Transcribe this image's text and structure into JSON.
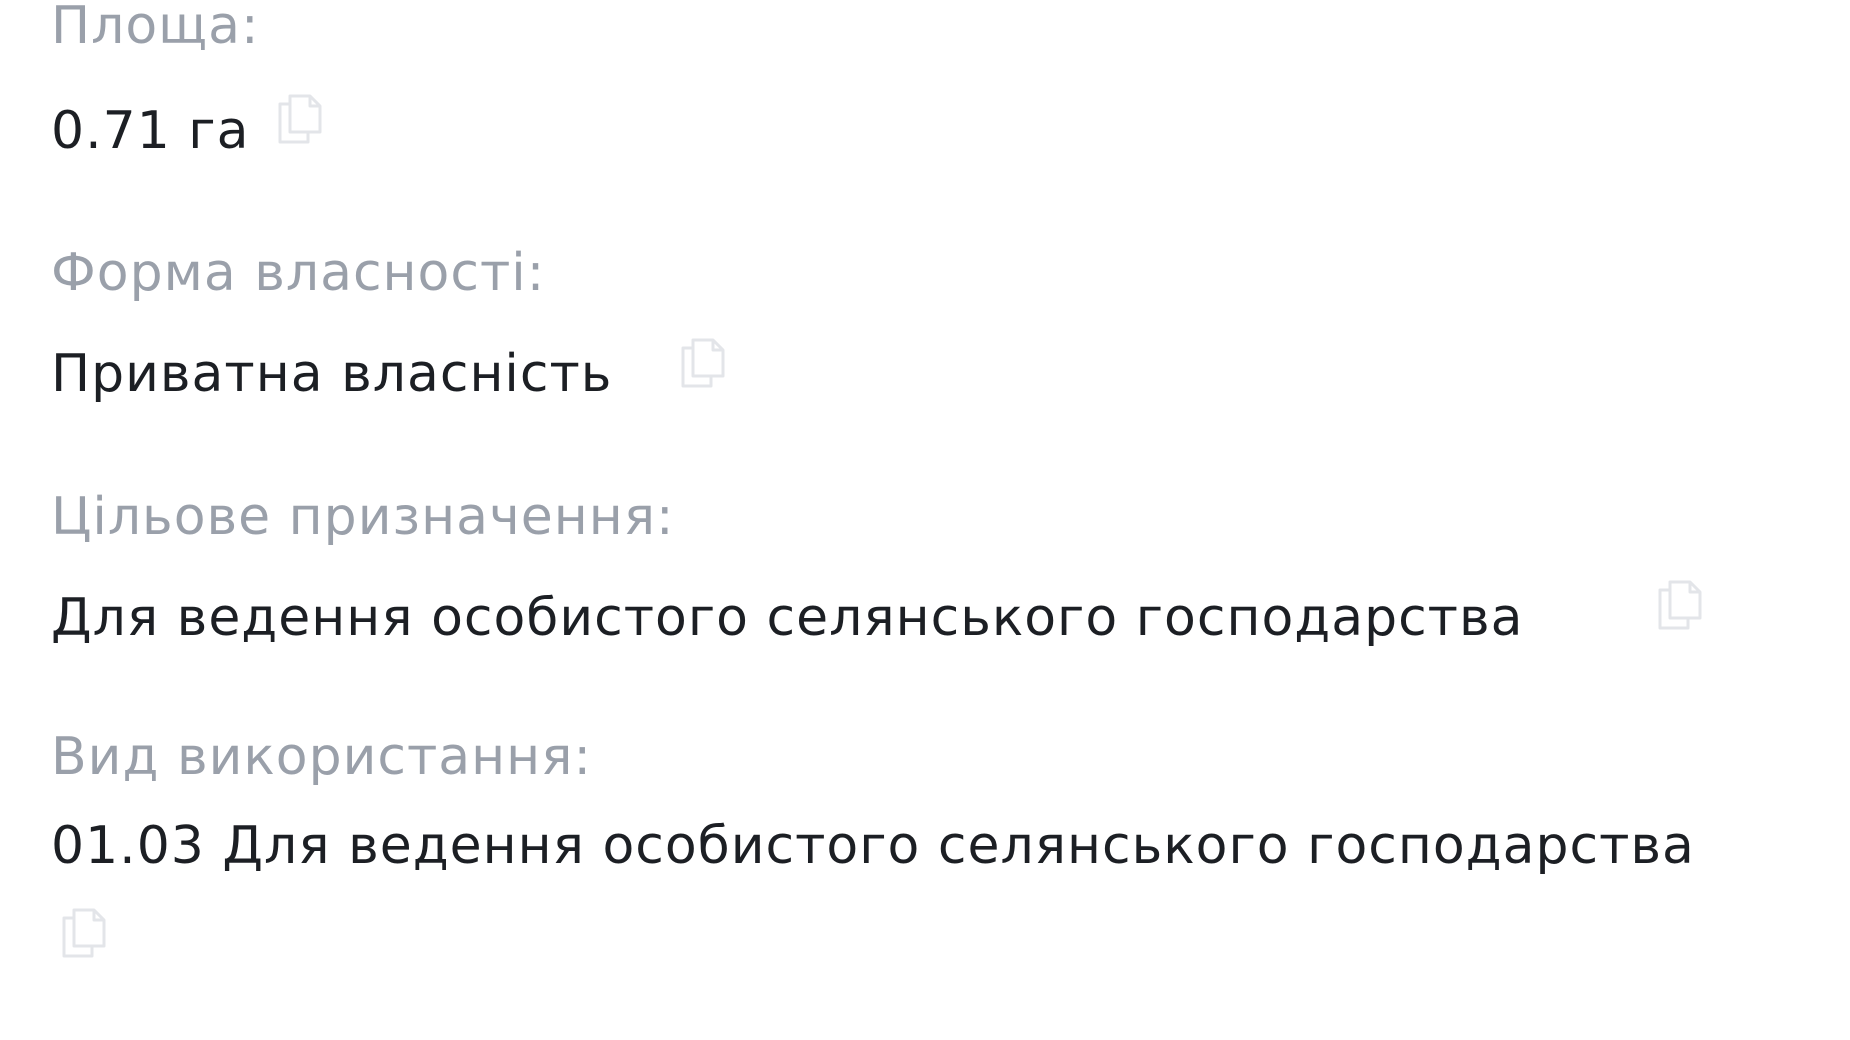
{
  "fields": [
    {
      "label": "Площа:",
      "value": "0.71 га"
    },
    {
      "label": "Форма власності:",
      "value": "Приватна власність"
    },
    {
      "label": "Цільове призначення:",
      "value": "Для ведення особистого селянського господарства"
    },
    {
      "label": "Вид використання:",
      "value": "01.03 Для ведення особистого селянського господарства"
    }
  ],
  "icons": {
    "copy": "copy-icon"
  },
  "colors": {
    "label": "#9aa0aa",
    "value": "#1c1f24",
    "icon": "#e4e6ea"
  }
}
